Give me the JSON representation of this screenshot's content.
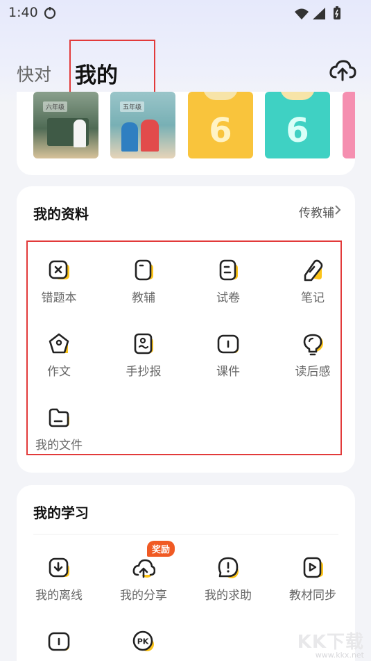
{
  "status_bar": {
    "time": "1:40"
  },
  "header": {
    "tab_kuaidui": "快对",
    "tab_wode": "我的"
  },
  "books": [
    {
      "cover_title": "六年级",
      "num": ""
    },
    {
      "cover_title": "五年级",
      "num": ""
    },
    {
      "cover_title": "",
      "num": "6"
    },
    {
      "cover_title": "",
      "num": "6"
    }
  ],
  "my_materials": {
    "title": "我的资料",
    "more_label": "传教辅",
    "items": [
      {
        "label": "错题本",
        "icon": "wrong-book-icon"
      },
      {
        "label": "教辅",
        "icon": "tutorial-icon"
      },
      {
        "label": "试卷",
        "icon": "test-paper-icon"
      },
      {
        "label": "笔记",
        "icon": "note-icon"
      },
      {
        "label": "作文",
        "icon": "composition-icon"
      },
      {
        "label": "手抄报",
        "icon": "handwritten-paper-icon"
      },
      {
        "label": "课件",
        "icon": "courseware-icon"
      },
      {
        "label": "读后感",
        "icon": "reading-icon"
      },
      {
        "label": "我的文件",
        "icon": "folder-icon"
      }
    ]
  },
  "my_study": {
    "title": "我的学习",
    "badge": "奖励",
    "items": [
      {
        "label": "我的离线",
        "icon": "offline-download-icon"
      },
      {
        "label": "我的分享",
        "icon": "share-upload-icon"
      },
      {
        "label": "我的求助",
        "icon": "help-icon"
      },
      {
        "label": "教材同步",
        "icon": "textbook-sync-icon"
      }
    ]
  },
  "watermark": {
    "logo": "KK下载",
    "url": "www.kkx.net"
  },
  "colors": {
    "accent": "#fcc419",
    "highlight": "#e23a3a",
    "badge": "#f05a24"
  }
}
